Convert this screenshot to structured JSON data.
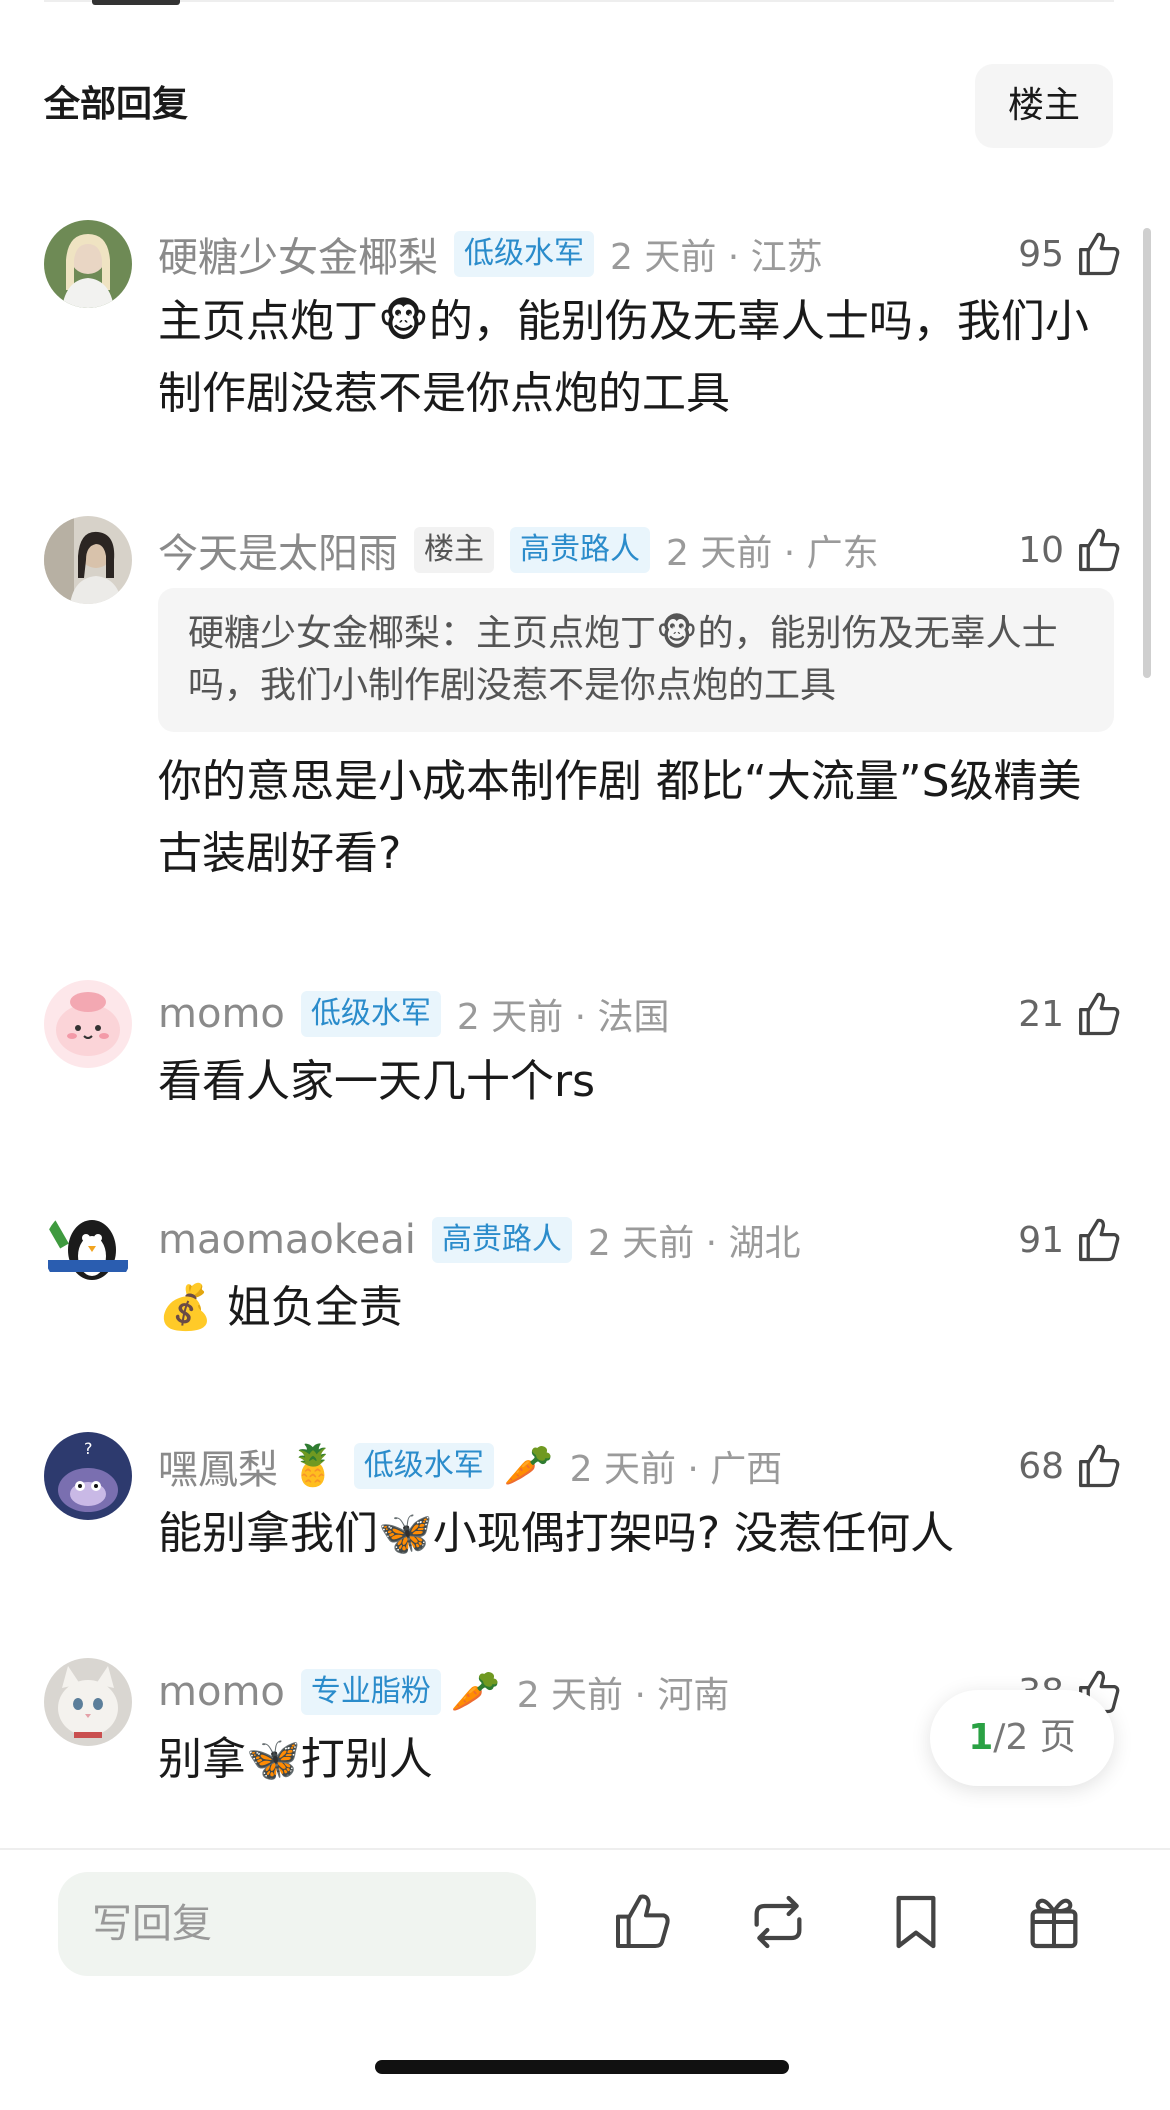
{
  "header": {
    "title": "全部回复",
    "filter_label": "楼主"
  },
  "comments": [
    {
      "name": "硬糖少女金椰梨",
      "tags": [
        "低级水军"
      ],
      "time": "2 天前 · 江苏",
      "likes": "95",
      "text_parts": [
        "主页点炮丁",
        "🐵",
        "的，能别伤及无辜人士吗，我们小制作剧没惹不是你点炮的工具"
      ],
      "avatar": "girl-photo-avatar"
    },
    {
      "name": "今天是太阳雨",
      "tags": [
        "楼主",
        "高贵路人"
      ],
      "time": "2 天前 · 广东",
      "likes": "10",
      "quote_parts": [
        "硬糖少女金椰梨：主页点炮丁",
        "🐵",
        "的，能别伤及无辜人士吗，我们小制作剧没惹不是你点炮的工具"
      ],
      "text": "你的意思是小成本制作剧  都比“大流量”S级精美古装剧好看?",
      "avatar": "woman-photo-avatar"
    },
    {
      "name": "momo",
      "tags": [
        "低级水军"
      ],
      "time": "2 天前 · 法国",
      "likes": "21",
      "text": "看看人家一天几十个rs",
      "avatar": "pink-cartoon-avatar"
    },
    {
      "name": "maomaokeai",
      "tags": [
        "高贵路人"
      ],
      "time": "2 天前 · 湖北",
      "likes": "91",
      "text_parts": [
        "💰",
        " 姐负全责"
      ],
      "avatar": "penguin-cartoon-avatar"
    },
    {
      "name": "嘿鳳梨",
      "name_emoji": "🍍",
      "tags": [
        "低级水军"
      ],
      "after_tag_emoji": "🥕",
      "time": "2 天前 · 广西",
      "likes": "68",
      "text_parts": [
        "能别拿我们",
        "🦋",
        "小现偶打架吗? 没惹任何人"
      ],
      "avatar": "cartoon-cat-avatar"
    },
    {
      "name": "momo",
      "tags": [
        "专业脂粉"
      ],
      "after_tag_emoji": "🥕",
      "time": "2 天前 · 河南",
      "likes": "38",
      "text_parts": [
        "别拿",
        "🦋",
        "打别人"
      ],
      "avatar": "white-cat-avatar"
    }
  ],
  "pagination": {
    "current": "1",
    "rest": "/2 页"
  },
  "footer": {
    "reply_placeholder": "写回复",
    "icons": [
      "like-icon",
      "repost-icon",
      "bookmark-icon",
      "gift-icon"
    ]
  },
  "colors": {
    "tag_blue_bg": "#e9f5fc",
    "tag_blue_text": "#2b8ccb",
    "page_accent": "#2aa144"
  }
}
